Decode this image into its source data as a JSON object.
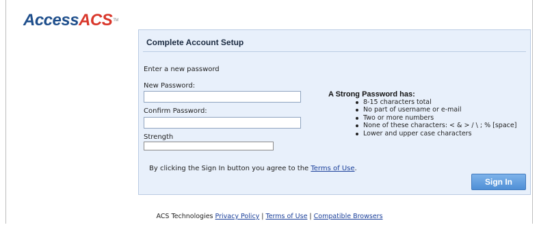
{
  "logo": {
    "access": "Access",
    "acs": "ACS",
    "tm": "TM"
  },
  "panel": {
    "title": "Complete Account Setup",
    "instruction": "Enter a new password",
    "new_password_label": "New Password:",
    "new_password_value": "",
    "confirm_password_label": "Confirm Password:",
    "confirm_password_value": "",
    "strength_label": "Strength",
    "strength_level": 0,
    "strong_title": "A Strong Password has:",
    "rules": [
      "8-15 characters total",
      "No part of username or e-mail",
      "Two or more numbers",
      "None of these characters: < & > / \\ ; % [space]",
      "Lower and upper case characters"
    ],
    "agree_prefix": "By clicking the Sign In button you agree to the ",
    "agree_link": "Terms of Use",
    "agree_suffix": ".",
    "sign_in_label": "Sign In"
  },
  "footer": {
    "company": "ACS Technologies",
    "privacy_link": "Privacy Policy",
    "separator": "|",
    "terms_link": "Terms of Use",
    "browsers_link": "Compatible Browsers"
  }
}
